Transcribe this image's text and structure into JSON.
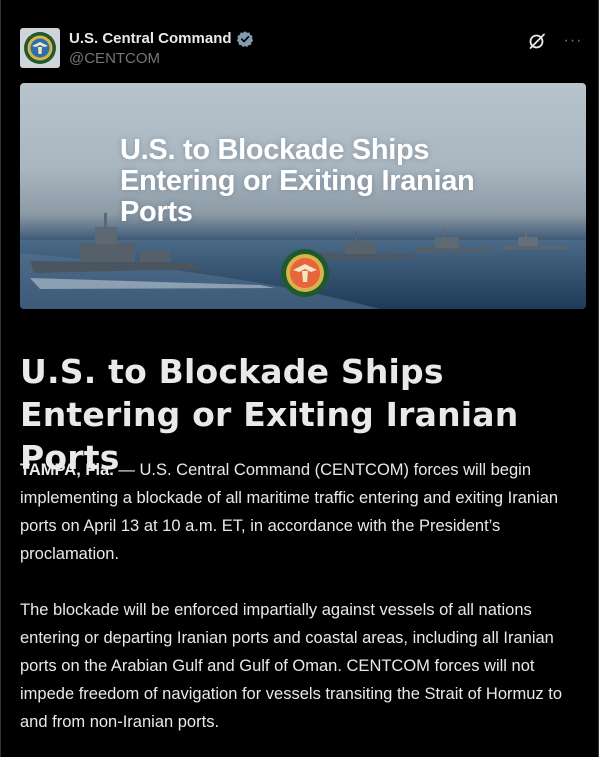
{
  "account": {
    "display_name": "U.S. Central Command",
    "handle": "@CENTCOM",
    "avatar_icon": "centcom-seal-icon",
    "verified_icon": "verified-badge-icon"
  },
  "toolbar": {
    "grok_icon": "grok-icon",
    "more_label": "···"
  },
  "media": {
    "title": "U.S. to Blockade Ships Entering or Exiting Iranian Ports",
    "seal_icon": "centcom-seal-icon"
  },
  "article": {
    "headline": "U.S. to Blockade Ships Entering or Exiting Iranian Ports",
    "p1_dateline": "TAMPA, Fla.",
    "p1_body": " — U.S. Central Command (CENTCOM) forces will begin implementing a blockade of all maritime traffic entering and exiting Iranian ports on April 13 at 10 a.m. ET, in accordance with the President’s proclamation.",
    "p2_body": "The blockade will be enforced impartially against vessels of all nations entering or departing Iranian ports and coastal areas, including all Iranian ports on the Arabian Gulf and Gulf of Oman. CENTCOM forces will not impede freedom of navigation for vessels transiting the Strait of Hormuz to and from non-Iranian ports."
  },
  "colors": {
    "background": "#000000",
    "text": "#e7e9ea",
    "muted": "#71767b",
    "verified": "#829aab"
  }
}
